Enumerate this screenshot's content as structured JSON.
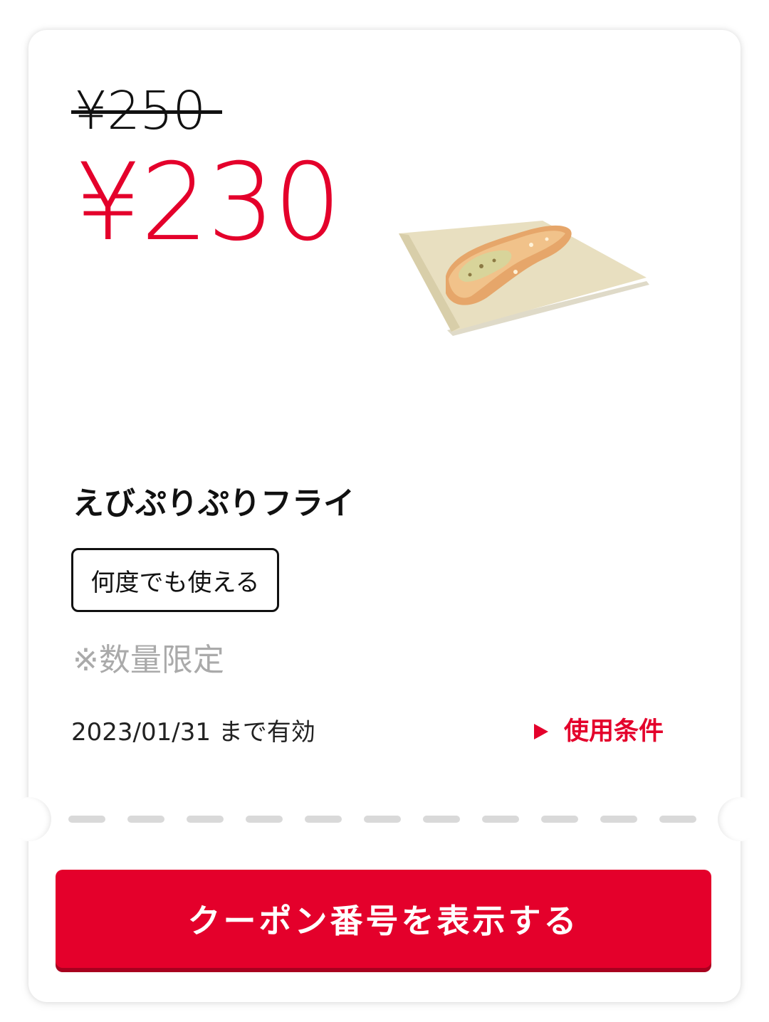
{
  "coupon": {
    "original_price": "¥250",
    "discount_price": "¥230",
    "product_name": "えびぷりぷりフライ",
    "product_image_alt": "えびぷりぷりフライ",
    "usage_badge": "何度でも使える",
    "limited_note": "※数量限定",
    "validity": "2023/01/31 まで有効",
    "terms_label": "使用条件",
    "show_code_button": "クーポン番号を表示する"
  },
  "colors": {
    "accent": "#e4002b",
    "text": "#111111",
    "muted": "#aaaaaa",
    "divider": "#d9d9d9"
  },
  "icons": {
    "terms": "triangle-right-icon"
  }
}
